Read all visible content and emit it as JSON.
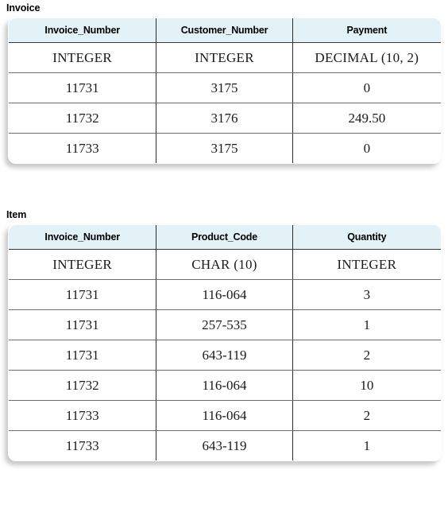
{
  "tables": [
    {
      "caption": "Invoice",
      "columns": [
        "Invoice_Number",
        "Customer_Number",
        "Payment"
      ],
      "datatypes": [
        "INTEGER",
        "INTEGER",
        "DECIMAL (10, 2)"
      ],
      "rows": [
        [
          "11731",
          "3175",
          "0"
        ],
        [
          "11732",
          "3176",
          "249.50"
        ],
        [
          "11733",
          "3175",
          "0"
        ]
      ]
    },
    {
      "caption": "Item",
      "columns": [
        "Invoice_Number",
        "Product_Code",
        "Quantity"
      ],
      "datatypes": [
        "INTEGER",
        "CHAR (10)",
        "INTEGER"
      ],
      "rows": [
        [
          "11731",
          "116-064",
          "3"
        ],
        [
          "11731",
          "257-535",
          "1"
        ],
        [
          "11731",
          "643-119",
          "2"
        ],
        [
          "11732",
          "116-064",
          "10"
        ],
        [
          "11733",
          "116-064",
          "2"
        ],
        [
          "11733",
          "643-119",
          "1"
        ]
      ]
    }
  ],
  "colors": {
    "header_background": "#e3f2f7",
    "page_background": "#ffffff",
    "border": "#2b2b2b",
    "row_divider": "#6d6d6d",
    "text": "#000000"
  }
}
